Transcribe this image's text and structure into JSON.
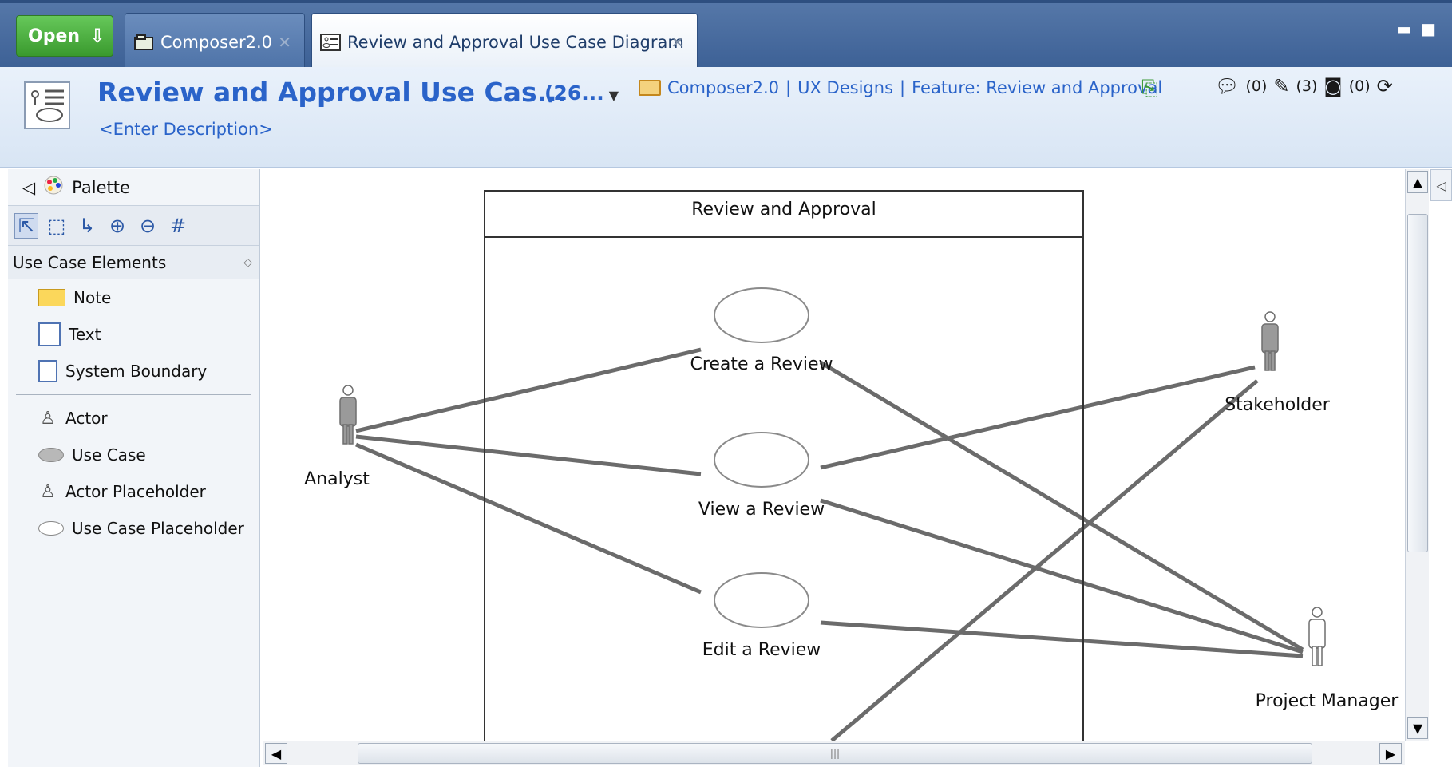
{
  "tabs": {
    "open_button": "Open",
    "items": [
      {
        "label": "Composer2.0"
      },
      {
        "label": "Review and Approval Use Case Diagram"
      }
    ]
  },
  "header": {
    "title": "Review and Approval Use Cas...",
    "version": "(26...",
    "description": "<Enter Description>",
    "breadcrumb": [
      "Composer2.0",
      "UX Designs",
      "Feature: Review and Approval"
    ],
    "separator": "|",
    "counters": {
      "comments": "(0)",
      "edits": "(3)",
      "approvals": "(0)"
    }
  },
  "palette": {
    "title": "Palette",
    "section": "Use Case Elements",
    "items": [
      {
        "label": "Note",
        "icon": "note-icon"
      },
      {
        "label": "Text",
        "icon": "text-icon"
      },
      {
        "label": "System Boundary",
        "icon": "system-boundary-icon"
      },
      {
        "label": "Actor",
        "icon": "actor-icon"
      },
      {
        "label": "Use Case",
        "icon": "use-case-icon"
      },
      {
        "label": "Actor Placeholder",
        "icon": "actor-placeholder-icon"
      },
      {
        "label": "Use Case Placeholder",
        "icon": "use-case-placeholder-icon"
      }
    ]
  },
  "diagram": {
    "boundary_title": "Review and Approval",
    "use_cases": [
      "Create a Review",
      "View a Review",
      "Edit a Review"
    ],
    "actors": [
      "Analyst",
      "Stakeholder",
      "Project Manager"
    ]
  },
  "colors": {
    "accent": "#2a63c9",
    "tabbar": "#3d6196",
    "open_button": "#3a9a2e",
    "association_line": "#6b6b6b"
  }
}
